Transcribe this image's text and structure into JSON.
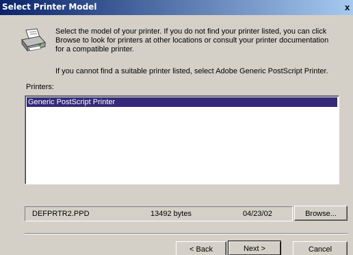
{
  "window": {
    "title": "Select Printer Model",
    "close_glyph": "x"
  },
  "instructions": {
    "icon": "printer-icon",
    "line1": "Select the model of your printer. If you do not find your printer listed, you can click",
    "line2": "Browse to look for printers at other locations or consult your printer documentation",
    "line3": "for a compatible printer.",
    "note": "If you cannot find a suitable printer listed, select Adobe Generic PostScript Printer."
  },
  "printers": {
    "label": "Printers:",
    "items": [
      {
        "name": "Generic PostScript Printer",
        "selected": true
      }
    ]
  },
  "file_info": {
    "filename": "DEFPRTR2.PPD",
    "size": "13492 bytes",
    "date": "04/23/02"
  },
  "buttons": {
    "browse": "Browse...",
    "back": "< Back",
    "next": "Next >",
    "cancel": "Cancel"
  },
  "colors": {
    "title_start": "#0a246a",
    "title_end": "#a6caf0",
    "selection": "#352a7a",
    "face": "#d4d0c8"
  }
}
